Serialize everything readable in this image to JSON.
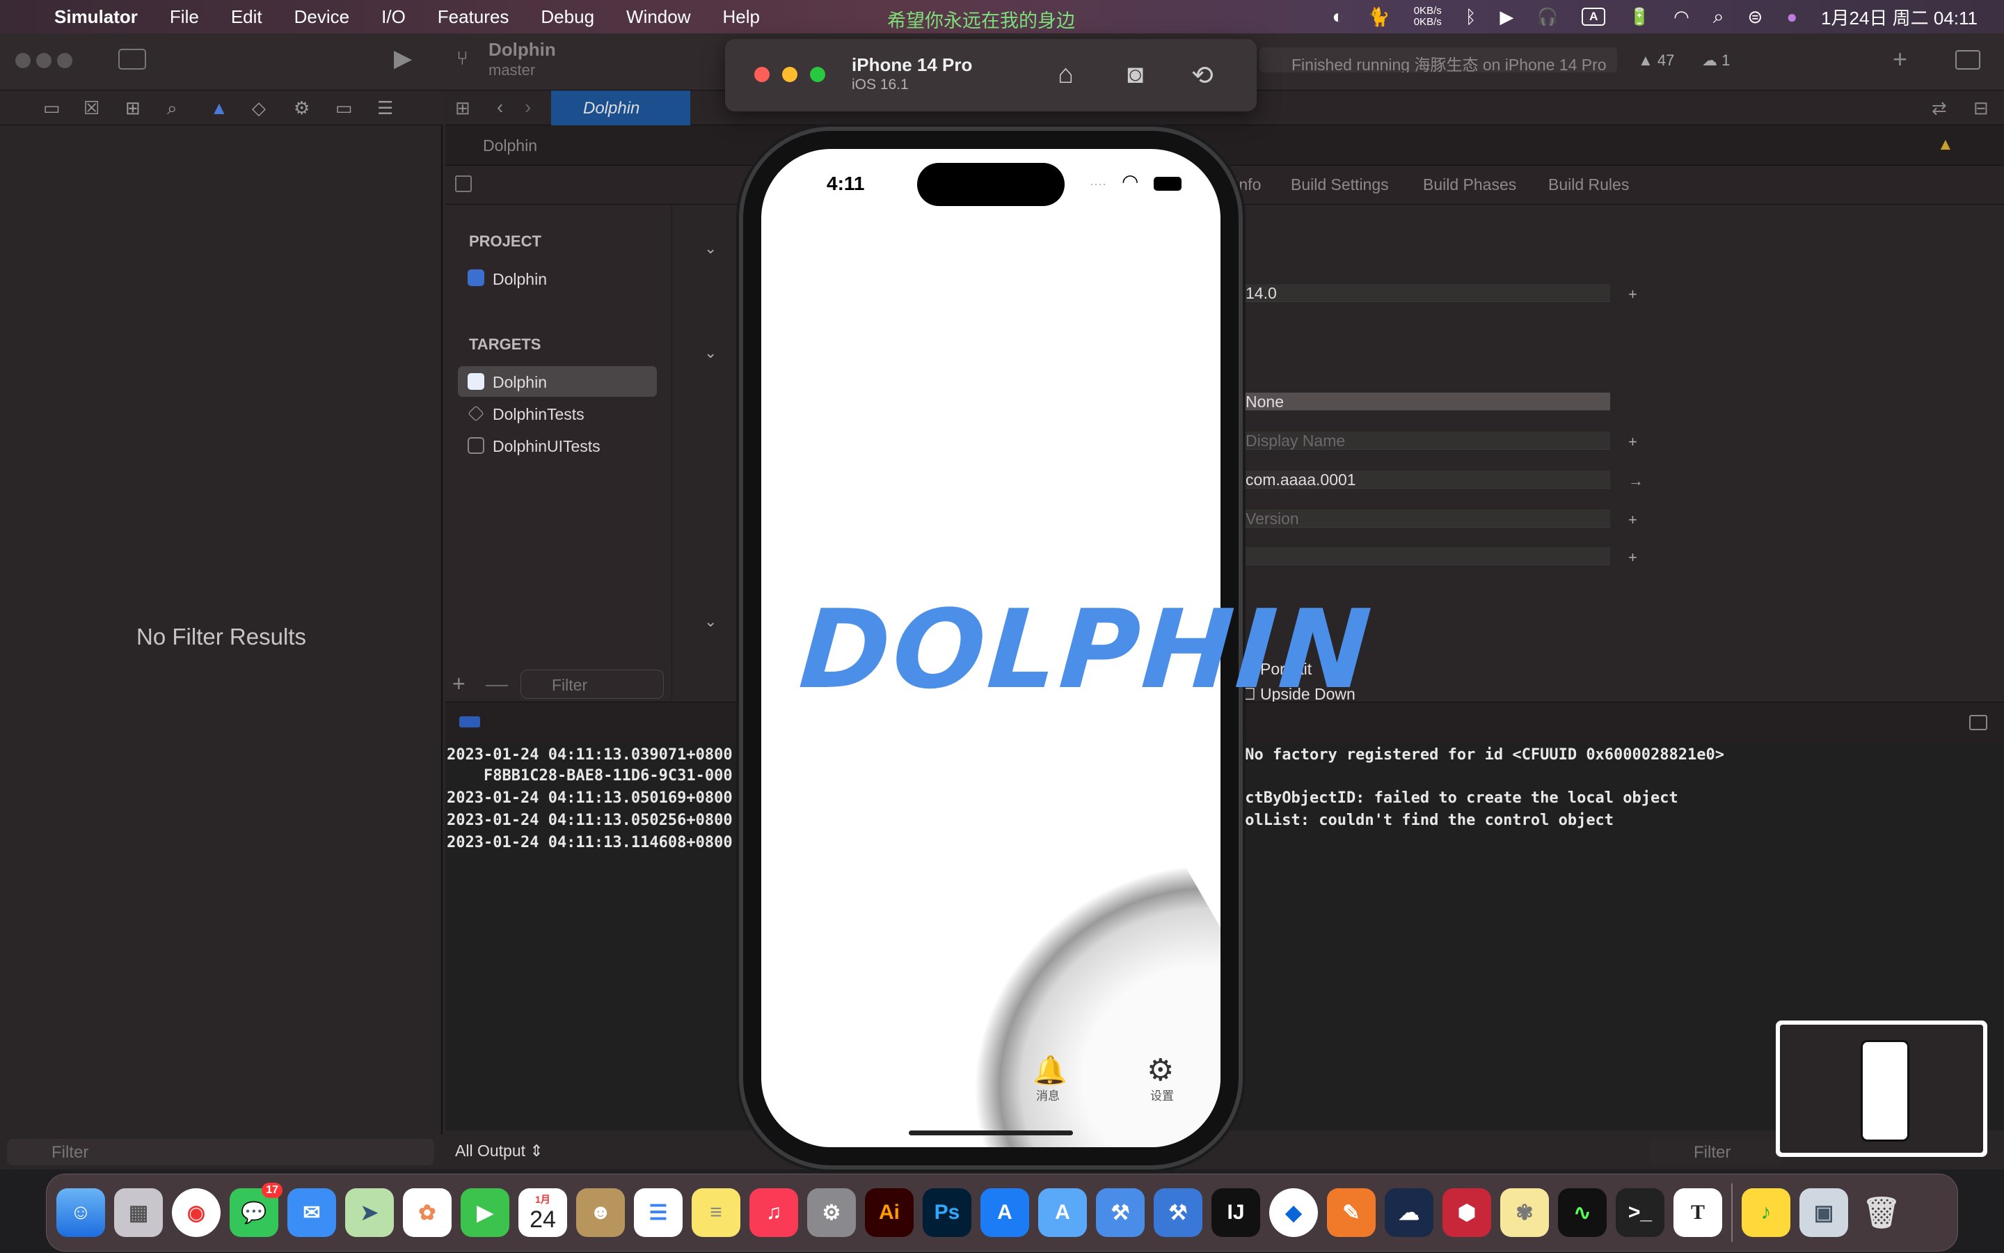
{
  "menubar": {
    "app_name": "Simulator",
    "menus": [
      "File",
      "Edit",
      "Device",
      "I/O",
      "Features",
      "Debug",
      "Window",
      "Help"
    ],
    "now_playing": "希望你永远在我的身边",
    "net_up": "0KB/s",
    "net_down": "0KB/s",
    "input_method": "A",
    "datetime": "1月24日 周二  04:11"
  },
  "xcode": {
    "project_name": "Dolphin",
    "branch": "master",
    "status": "Finished running 海豚生态 on iPhone 14 Pro",
    "warnings": "47",
    "issues": "1",
    "tab_label": "Dolphin",
    "jumpbar": "Dolphin",
    "settings_tabs": [
      "Info",
      "Build Settings",
      "Build Phases",
      "Build Rules"
    ],
    "navigator_empty": "No Filter Results",
    "navigator_filter_placeholder": "Filter",
    "project_header": "PROJECT",
    "project_item": "Dolphin",
    "targets_header": "TARGETS",
    "targets": [
      "Dolphin",
      "DolphinTests",
      "DolphinUITests"
    ],
    "list_filter_placeholder": "Filter",
    "min_deployment": "14.0",
    "app_category": "None",
    "display_name_placeholder": "Display Name",
    "bundle_identifier": "com.aaaa.0001",
    "version_placeholder": "Version",
    "orientation_portrait": "Portrait",
    "orientation_upside_down": "Upside Down",
    "output_selector": "All Output ⇕",
    "console_filter_placeholder": "Filter",
    "console_lines_left": [
      "2023-01-24 04:11:13.039071+0800",
      "    F8BB1C28-BAE8-11D6-9C31-000",
      "2023-01-24 04:11:13.050169+0800",
      "2023-01-24 04:11:13.050256+0800",
      "2023-01-24 04:11:13.114608+0800"
    ],
    "console_lines_right": [
      " No factory registered for id <CFUUID 0x6000028821e0>",
      "",
      "ectByObjectID: failed to create the local object",
      "rolList: couldn't find the control object",
      ""
    ]
  },
  "simulator": {
    "device": "iPhone 14 Pro",
    "os": "iOS 16.1",
    "clock": "4:11",
    "logo_text": "DOLPHIN",
    "tab_messages": "消息",
    "tab_settings": "设置"
  },
  "dock": {
    "calendar_month": "1月",
    "calendar_day": "24",
    "messages_badge": "17"
  },
  "colors": {
    "logo_blue": "#4c8fe8",
    "now_playing_green": "#7de07a",
    "selected_tab": "#1b4f8d"
  }
}
